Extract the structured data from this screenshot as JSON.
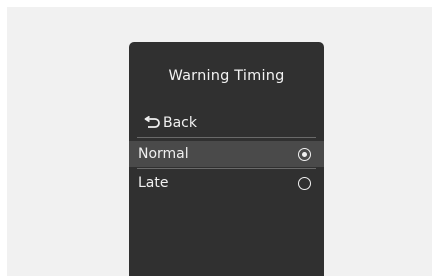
{
  "menu": {
    "title": "Warning Timing",
    "back_label": "Back",
    "options": [
      {
        "label": "Normal",
        "selected": true
      },
      {
        "label": "Late",
        "selected": false
      }
    ]
  },
  "colors": {
    "panel": "#303030",
    "highlight": "#4a4a4a",
    "text": "#f0f0f0",
    "backdrop": "#f1f1f1"
  }
}
